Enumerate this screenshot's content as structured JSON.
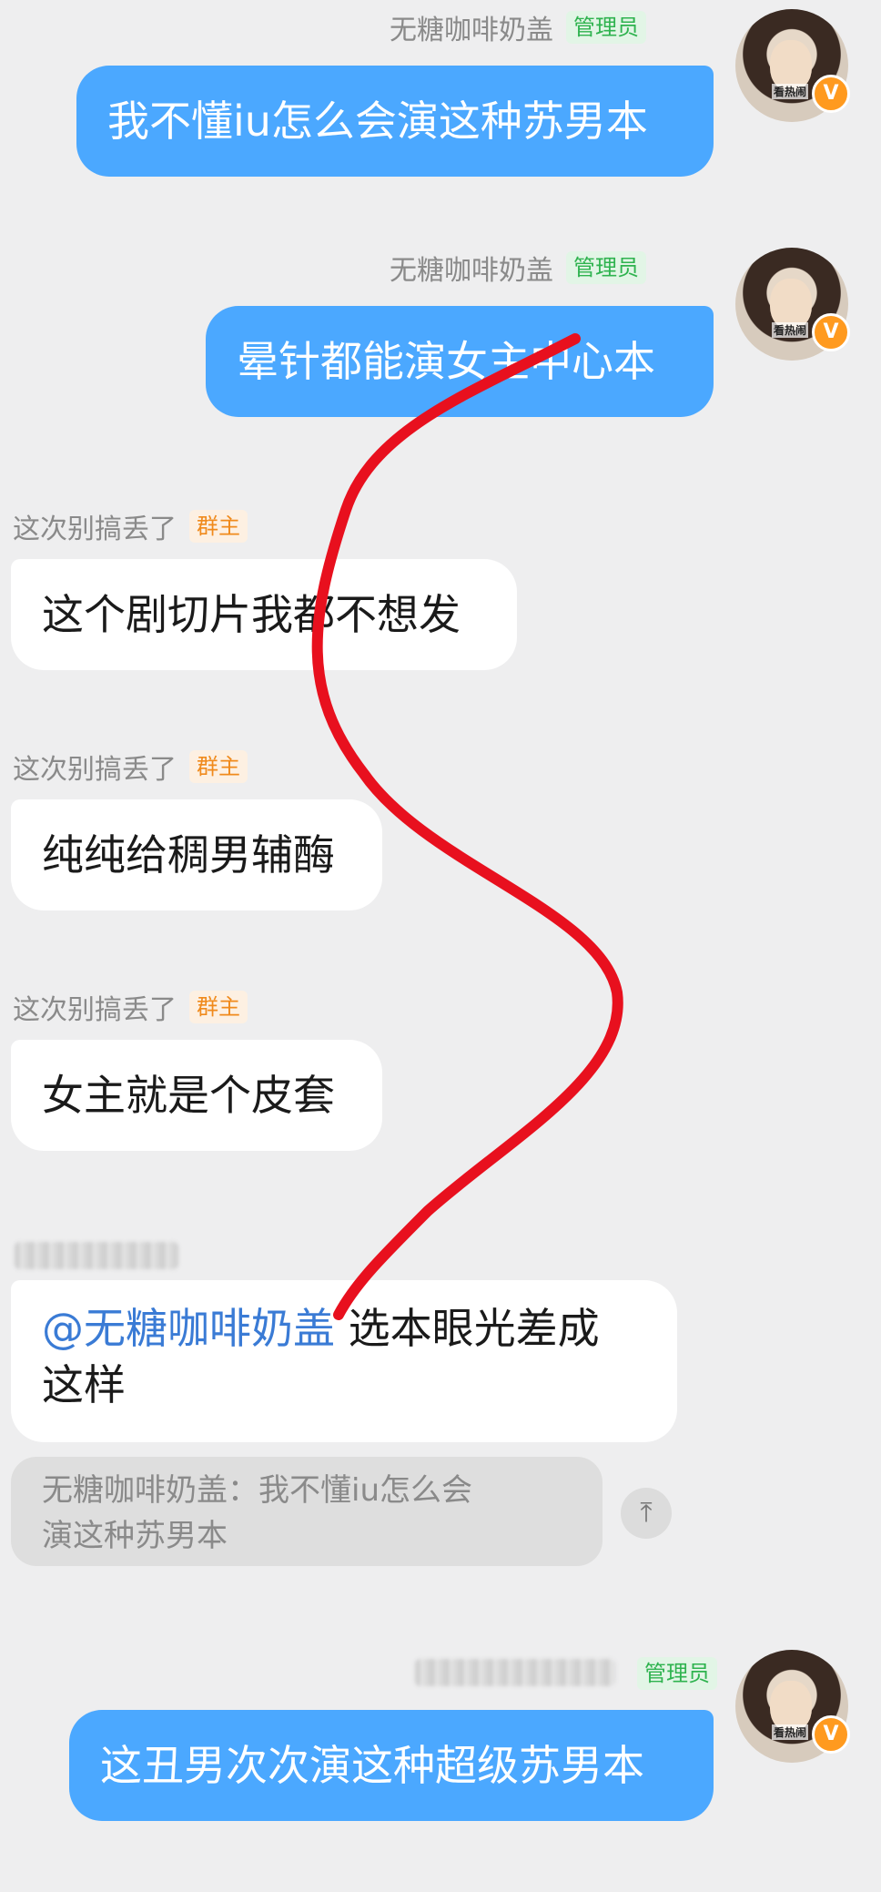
{
  "messages": [
    {
      "sender": "无糖咖啡奶盖",
      "tag": "管理员",
      "text": "我不懂iu怎么会演这种苏男本"
    },
    {
      "sender": "无糖咖啡奶盖",
      "tag": "管理员",
      "text": "晕针都能演女主中心本"
    },
    {
      "sender": "这次别搞丢了",
      "tag": "群主",
      "text": "这个剧切片我都不想发"
    },
    {
      "sender": "这次别搞丢了",
      "tag": "群主",
      "text": "纯纯给稠男辅酶"
    },
    {
      "sender": "这次别搞丢了",
      "tag": "群主",
      "text": "女主就是个皮套"
    },
    {
      "mention": "@无糖咖啡奶盖",
      "text_line1": " 选本眼光差成",
      "text_line2": "这样",
      "quote_line1": "无糖咖啡奶盖：我不懂iu怎么会",
      "quote_line2": "演这种苏男本"
    },
    {
      "tag": "管理员",
      "text": "这丑男次次演这种超级苏男本"
    }
  ],
  "avatar": {
    "caption": "看热闹",
    "badge": "V"
  },
  "scroll_top_icon": "arrow-up-icon",
  "colors": {
    "background": "#eeeeef",
    "bubble_self": "#4ba8ff",
    "bubble_other": "#ffffff",
    "admin_tag": "#2fb34f",
    "owner_tag": "#f08a1c",
    "annotation": "#e8101e"
  }
}
